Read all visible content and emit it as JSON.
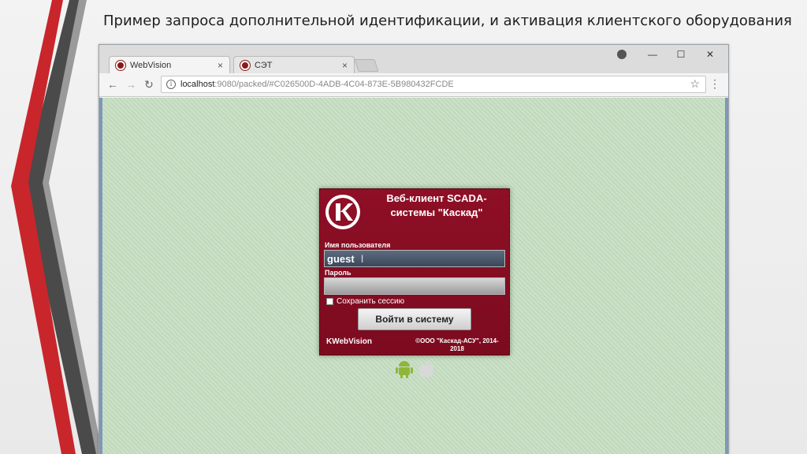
{
  "slide": {
    "title": "Пример запроса дополнительной идентификации, и активация клиентского оборудования"
  },
  "browser": {
    "tabs": [
      {
        "title": "WebVision",
        "close": "×"
      },
      {
        "title": "СЭТ",
        "close": "×"
      }
    ],
    "window_controls": {
      "minimize": "—",
      "maximize": "☐",
      "close": "✕"
    },
    "address": {
      "host": "localhost",
      "rest": ":9080/packed/#C026500D-4ADB-4C04-873E-5B980432FCDE"
    },
    "nav": {
      "back": "←",
      "forward": "→",
      "reload": "↻"
    },
    "star": "☆",
    "menu": "⋮",
    "info": "i"
  },
  "login": {
    "title": "Веб-клиент SCADA-системы \"Каскад\"",
    "logo_letter": "K",
    "username_label": "Имя пользователя",
    "username_value": "guest",
    "caret": "I",
    "password_label": "Пароль",
    "password_value": "",
    "remember_label": "Сохранить сессию",
    "submit_label": "Войти в систему",
    "brand": "KWebVision",
    "copyright": "©ООО \"Каскад-АСУ\", 2014-2018"
  },
  "colors": {
    "dialog": "#8e0f26",
    "viewport": "#c7dfc3",
    "deco_red": "#c8262b",
    "deco_dark": "#505050"
  },
  "icons": {
    "android": "android-icon",
    "apple": "apple-icon"
  }
}
